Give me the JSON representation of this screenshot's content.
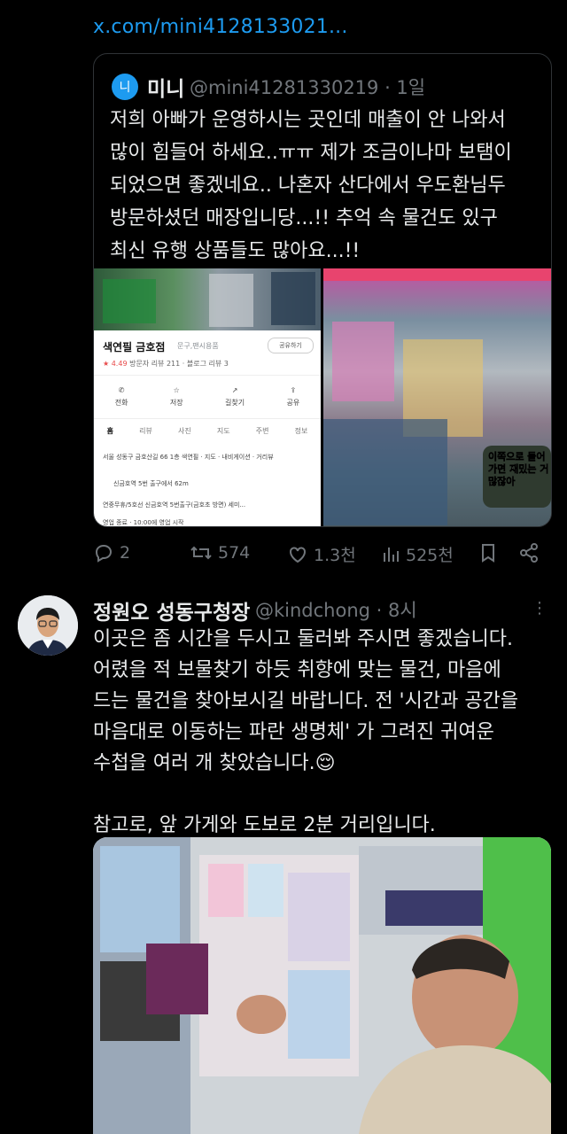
{
  "link": {
    "text": "x.com/mini4128133021..."
  },
  "quote": {
    "avatar_letter": "니",
    "name": "미니",
    "handle_time": "@mini41281330219 · 1일",
    "text": "저희 아빠가 운영하시는 곳인데 매출이 안 나와서\n많이 힘들어 하세요..ㅠㅠ 제가 조금이나마 보탬이\n되었으면 좋겠네요.. 나혼자 산다에서 우도환님두\n방문하셨던 매장입니당...!! 추억 속 물건도 있구\n최신 유행 상품들도 많아요...!!",
    "map_card": {
      "place": "색연필 금호점",
      "category": "문구,팬시용품",
      "share": "공유하기",
      "rating": "★ 4.49",
      "reviews": "방문자 리뷰 211 · 블로그 리뷰 3",
      "actions": [
        "전화",
        "저장",
        "길찾기",
        "공유"
      ],
      "tabs": [
        "홈",
        "리뷰",
        "사진",
        "지도",
        "주변",
        "정보"
      ],
      "address": "서울 성동구 금호산길 66 1층 색연필 · 지도 · 내비게이션 · 거리뷰",
      "subway": "신금호역 5번 출구에서 62m",
      "bus": "연중무휴/5호선 신금호역 5번출구(금호초 방면) 세미...",
      "hours": "영업 종료 · 10:00에 영업 시작"
    },
    "video_caption": "이쪽으로 들어가면 재밌는 거 많잖아"
  },
  "actions": {
    "reply": "2",
    "retweet": "574",
    "like": "1.3천",
    "views": "525천"
  },
  "reply": {
    "name": "정원오 성동구청장",
    "handle_time": "@kindchong · 8시",
    "text": "이곳은 좀 시간을 두시고 둘러봐 주시면 좋겠습니다.\n어렸을 적 보물찾기 하듯 취향에 맞는 물건, 마음에\n드는 물건을 찾아보시길 바랍니다. 전 '시간과 공간을\n마음대로 이동하는 파란 생명체' 가 그려진 귀여운\n수첩을 여러 개 찾았습니다.😌\n\n참고로, 앞 가게와 도보로 2분 거리입니다."
  },
  "colors": {
    "accent": "#1d9bf0",
    "muted": "#71767b",
    "text": "#e7e9ea",
    "bg": "#000000"
  }
}
